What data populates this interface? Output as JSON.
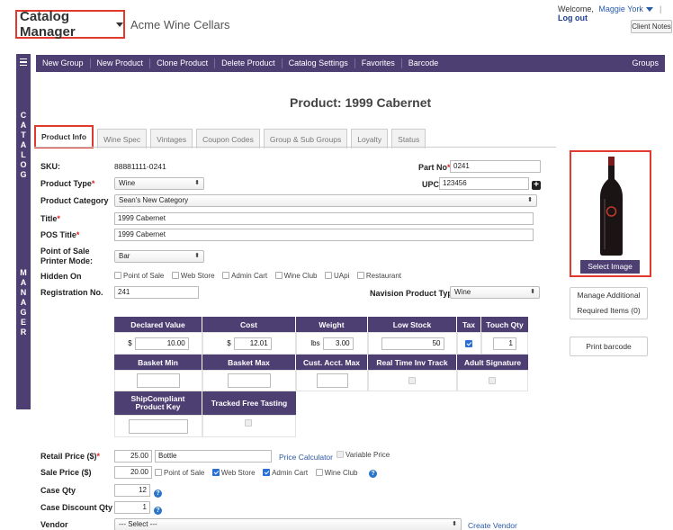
{
  "header": {
    "app_name": "Catalog Manager",
    "company": "Acme Wine Cellars",
    "welcome_text": "Welcome,",
    "user_name": "Maggie York",
    "logout": "Log out",
    "client_notes": "Client Notes"
  },
  "sidebar": {
    "letters_top": [
      "C",
      "A",
      "T",
      "A",
      "L",
      "O",
      "G"
    ],
    "letters_bottom": [
      "M",
      "A",
      "N",
      "A",
      "G",
      "E",
      "R"
    ]
  },
  "toolbar": {
    "items": [
      "New Group",
      "New Product",
      "Clone Product",
      "Delete Product",
      "Catalog Settings",
      "Favorites",
      "Barcode"
    ],
    "groups": "Groups"
  },
  "page_title": "Product: 1999 Cabernet",
  "tabs": [
    "Product Info",
    "Wine Spec",
    "Vintages",
    "Coupon Codes",
    "Group & Sub Groups",
    "Loyalty",
    "Status"
  ],
  "form": {
    "sku_label": "SKU:",
    "sku_value": "88881111-0241",
    "part_no_label": "Part No",
    "part_no_value": "0241",
    "product_type_label": "Product Type",
    "product_type_value": "Wine",
    "upc_label": "UPC",
    "upc_value": "123456",
    "product_category_label": "Product Category",
    "product_category_value": "Sean's New Category",
    "title_label": "Title",
    "title_value": "1999 Cabernet",
    "pos_title_label": "POS Title",
    "pos_title_value": "1999 Cabernet",
    "pos_printer_label_1": "Point of Sale",
    "pos_printer_label_2": "Printer Mode:",
    "pos_printer_value": "Bar",
    "hidden_on_label": "Hidden On",
    "hidden_on_options": [
      "Point of Sale",
      "Web Store",
      "Admin Cart",
      "Wine Club",
      "UApi",
      "Restaurant"
    ],
    "registration_label": "Registration No.",
    "registration_value": "241",
    "navision_label": "Navision Product Type",
    "navision_value": "Wine"
  },
  "spec_grid": {
    "row1_headers": [
      "Declared Value",
      "Cost",
      "Weight",
      "Low Stock",
      "Tax",
      "Touch Qty"
    ],
    "declared_prefix": "$",
    "declared_value": "10.00",
    "cost_prefix": "$",
    "cost_value": "12.01",
    "weight_prefix": "lbs",
    "weight_value": "3.00",
    "low_stock_value": "50",
    "tax_checked": true,
    "touch_qty_value": "1",
    "row2_headers": [
      "Basket Min",
      "Basket Max",
      "Cust. Acct. Max",
      "Real Time Inv Track",
      "Adult Signature"
    ],
    "row3_headers": [
      "ShipCompliant Product Key",
      "Tracked Free Tasting"
    ]
  },
  "pricing": {
    "retail_label": "Retail Price ($)",
    "retail_value": "25.00",
    "retail_unit": "Bottle",
    "price_calculator": "Price Calculator",
    "variable_price": "Variable Price",
    "sale_label": "Sale Price ($)",
    "sale_value": "20.00",
    "sale_options": [
      {
        "label": "Point of Sale",
        "checked": false
      },
      {
        "label": "Web Store",
        "checked": true
      },
      {
        "label": "Admin Cart",
        "checked": true
      },
      {
        "label": "Wine Club",
        "checked": false
      }
    ],
    "case_qty_label": "Case Qty",
    "case_qty_value": "12",
    "case_discount_label": "Case Discount Qty",
    "case_discount_value": "1",
    "vendor_label": "Vendor",
    "vendor_value": "--- Select ---",
    "create_vendor": "Create Vendor"
  },
  "right_panel": {
    "select_image": "Select Image",
    "manage_line1": "Manage Additional",
    "manage_line2": "Required Items (0)",
    "print_barcode": "Print barcode"
  },
  "colors": {
    "brand_purple": "#4e3f73",
    "highlight_red": "#e03a2f",
    "link_blue": "#2a5aa8"
  }
}
